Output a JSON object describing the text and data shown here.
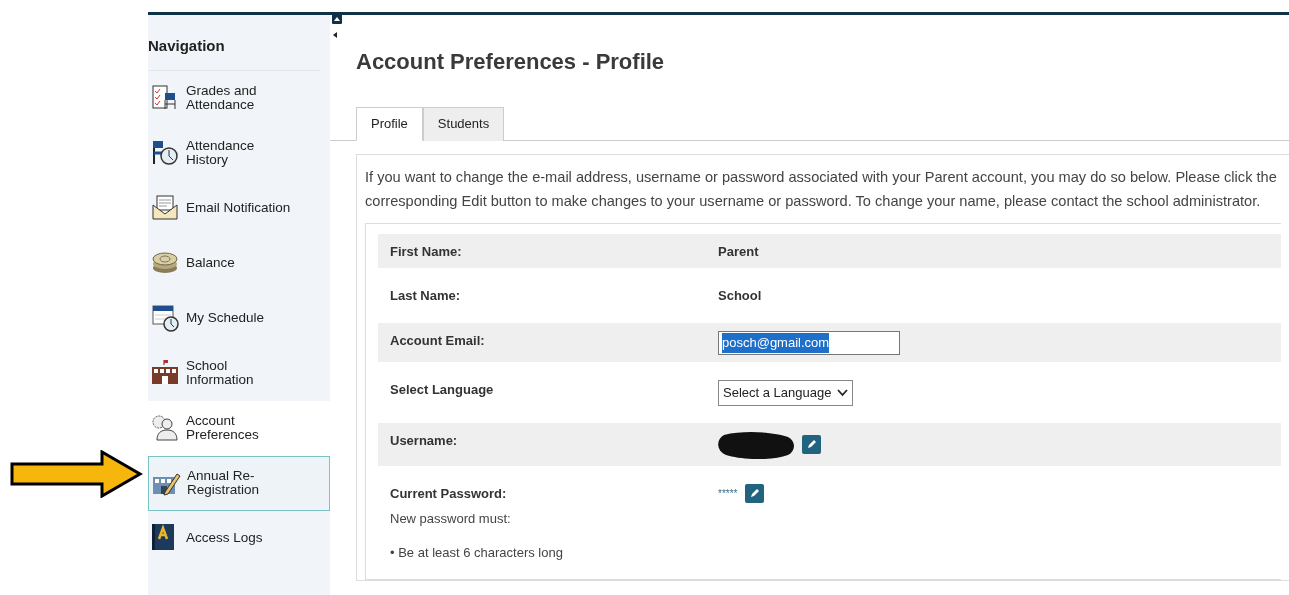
{
  "sidebar": {
    "title": "Navigation",
    "items": [
      {
        "label": "Grades and Attendance",
        "selected": false,
        "outlined": false
      },
      {
        "label": "Attendance History",
        "selected": false,
        "outlined": false
      },
      {
        "label": "Email Notification",
        "selected": false,
        "outlined": false
      },
      {
        "label": "Balance",
        "selected": false,
        "outlined": false
      },
      {
        "label": "My Schedule",
        "selected": false,
        "outlined": false
      },
      {
        "label": "School Information",
        "selected": false,
        "outlined": false
      },
      {
        "label": "Account Preferences",
        "selected": true,
        "outlined": false
      },
      {
        "label": "Annual Re-Registration",
        "selected": false,
        "outlined": true
      },
      {
        "label": "Access Logs",
        "selected": false,
        "outlined": false
      }
    ]
  },
  "page": {
    "title": "Account Preferences - Profile",
    "tabs": [
      {
        "label": "Profile",
        "selected": true
      },
      {
        "label": "Students",
        "selected": false
      }
    ],
    "intro": "If you want to change the e-mail address, username or password associated with your Parent account, you may do so below. Please click the corresponding Edit button to make changes to your username or password. To change your name, please contact the school administrator.",
    "rows": [
      {
        "label": "First Name:",
        "kind": "text",
        "value": "Parent"
      },
      {
        "label": "Last Name:",
        "kind": "text",
        "value": "School"
      },
      {
        "label": "Account Email:",
        "kind": "input",
        "value": "posch@gmail.com"
      },
      {
        "label": "Select Language",
        "kind": "select",
        "value": "Select a Language"
      },
      {
        "label": "Username:",
        "kind": "redacted",
        "editable": true
      },
      {
        "label": "Current Password:",
        "kind": "password",
        "value": "*****",
        "editable": true,
        "notes": [
          "New password must:",
          "• Be at least 6 characters long"
        ]
      }
    ]
  },
  "annotation": {
    "kind": "arrow"
  }
}
